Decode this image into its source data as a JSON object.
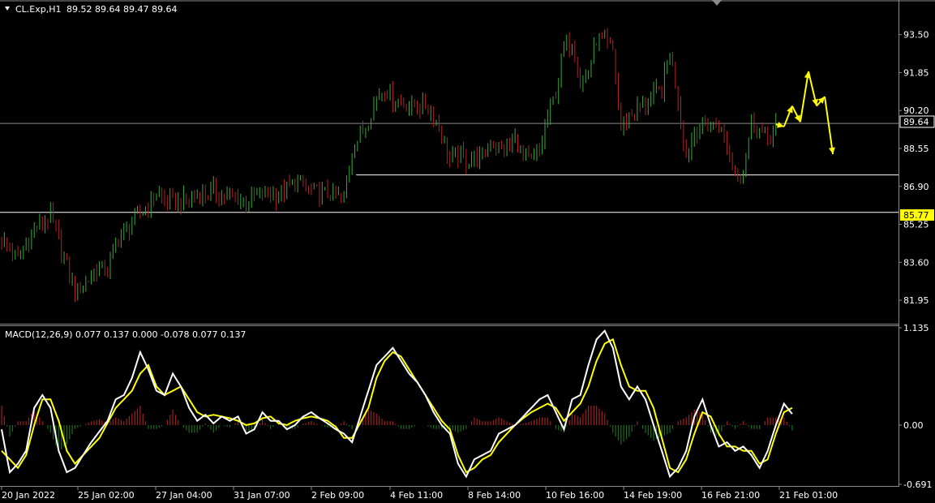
{
  "chart_header": {
    "symbol_label": "CL.Exp,H1",
    "ohlc_text": "89.52 89.64 89.47 89.64",
    "macd_label": "MACD(12,26,9) 0.077 0.137 0.000 -0.078 0.077 0.137"
  },
  "colors": {
    "background": "#000000",
    "bull_candle": "#3aa83a",
    "bear_candle": "#b22222",
    "yellow": "#ffff00",
    "white": "#ffffff",
    "gray_line": "#8a8a8a",
    "hist_pos": "#a11e1e",
    "hist_neg": "#1d6b1d"
  },
  "chart_data": [
    {
      "type": "candlestick",
      "title": "CL.Exp,H1",
      "ylim": [
        81.0,
        94.3
      ],
      "y_ticks": [
        "93.50",
        "91.85",
        "90.20",
        "88.55",
        "86.90",
        "85.25",
        "83.60",
        "81.95"
      ],
      "y_tick_values": [
        93.5,
        91.85,
        90.2,
        88.55,
        86.9,
        85.25,
        83.6,
        81.95
      ],
      "x_ticks": [
        "20 Jan 2022",
        "25 Jan 02:00",
        "27 Jan 04:00",
        "31 Jan 07:00",
        "2 Feb 09:00",
        "4 Feb 11:00",
        "8 Feb 14:00",
        "10 Feb 16:00",
        "14 Feb 19:00",
        "16 Feb 21:00",
        "21 Feb 01:00"
      ],
      "current_price": "89.64",
      "current_price_value": 89.64,
      "support_label": "85.77",
      "support_value": 85.77,
      "horizontal_level_2": 87.4,
      "close_path": [
        [
          0,
          84.6
        ],
        [
          2,
          83.7
        ],
        [
          4,
          85.0
        ],
        [
          6,
          85.6
        ],
        [
          7,
          84.5
        ],
        [
          9,
          82.3
        ],
        [
          10,
          82.6
        ],
        [
          12,
          83.4
        ],
        [
          13,
          83.2
        ],
        [
          14,
          84.5
        ],
        [
          15,
          84.9
        ],
        [
          16,
          85.3
        ],
        [
          18,
          86.1
        ],
        [
          19,
          86.6
        ],
        [
          20,
          86.3
        ],
        [
          22,
          86.2
        ],
        [
          24,
          86.5
        ],
        [
          26,
          86.7
        ],
        [
          28,
          86.4
        ],
        [
          30,
          86.3
        ],
        [
          32,
          86.6
        ],
        [
          34,
          86.5
        ],
        [
          36,
          87.1
        ],
        [
          38,
          86.7
        ],
        [
          39,
          86.6
        ],
        [
          41,
          86.5
        ],
        [
          42,
          86.3
        ],
        [
          43,
          88.5
        ],
        [
          45,
          89.8
        ],
        [
          46,
          90.8
        ],
        [
          47,
          91.2
        ],
        [
          48,
          90.7
        ],
        [
          50,
          90.4
        ],
        [
          52,
          90.4
        ],
        [
          53,
          90.0
        ],
        [
          54,
          89.2
        ],
        [
          55,
          88.0
        ],
        [
          56,
          88.3
        ],
        [
          57,
          88.0
        ],
        [
          58,
          88.2
        ],
        [
          59,
          88.1
        ],
        [
          60,
          88.8
        ],
        [
          62,
          88.5
        ],
        [
          63,
          89.0
        ],
        [
          64,
          88.1
        ],
        [
          65,
          88.0
        ],
        [
          66,
          88.4
        ],
        [
          67,
          89.9
        ],
        [
          68,
          91.0
        ],
        [
          69,
          92.9
        ],
        [
          70,
          93.2
        ],
        [
          71,
          91.5
        ],
        [
          72,
          91.8
        ],
        [
          73,
          93.3
        ],
        [
          74,
          93.1
        ],
        [
          75,
          92.8
        ],
        [
          76,
          89.4
        ],
        [
          77,
          90.0
        ],
        [
          78,
          90.3
        ],
        [
          79,
          90.4
        ],
        [
          80,
          90.9
        ],
        [
          81,
          91.1
        ],
        [
          82,
          92.8
        ],
        [
          83,
          90.7
        ],
        [
          84,
          88.2
        ],
        [
          85,
          89.3
        ],
        [
          86,
          89.5
        ],
        [
          87,
          89.5
        ],
        [
          88,
          89.6
        ],
        [
          89,
          88.6
        ],
        [
          90,
          87.6
        ],
        [
          91,
          87.5
        ],
        [
          92,
          89.8
        ],
        [
          93,
          89.4
        ],
        [
          94,
          89.0
        ],
        [
          95,
          89.6
        ]
      ],
      "forecast_path": [
        [
          95,
          89.6
        ],
        [
          96,
          89.5
        ],
        [
          97,
          90.4
        ],
        [
          98,
          89.7
        ],
        [
          99,
          91.9
        ],
        [
          100,
          90.4
        ],
        [
          101,
          90.8
        ],
        [
          102,
          88.3
        ]
      ],
      "n_candles": 103
    },
    {
      "type": "macd",
      "title": "MACD(12,26,9)",
      "ylim": [
        -0.691,
        1.135
      ],
      "y_ticks": [
        "1.135",
        "0.00",
        "-0.691"
      ],
      "y_tick_values": [
        1.135,
        0.0,
        -0.691
      ],
      "macd_path": [
        [
          0,
          -0.05
        ],
        [
          1,
          -0.55
        ],
        [
          2,
          -0.45
        ],
        [
          3,
          -0.3
        ],
        [
          4,
          0.2
        ],
        [
          5,
          0.35
        ],
        [
          6,
          0.2
        ],
        [
          7,
          -0.3
        ],
        [
          8,
          -0.55
        ],
        [
          9,
          -0.5
        ],
        [
          11,
          -0.2
        ],
        [
          13,
          0.05
        ],
        [
          14,
          0.3
        ],
        [
          15,
          0.35
        ],
        [
          16,
          0.55
        ],
        [
          17,
          0.85
        ],
        [
          18,
          0.65
        ],
        [
          19,
          0.4
        ],
        [
          20,
          0.35
        ],
        [
          21,
          0.6
        ],
        [
          22,
          0.45
        ],
        [
          23,
          0.2
        ],
        [
          24,
          0.05
        ],
        [
          25,
          0.12
        ],
        [
          26,
          0.02
        ],
        [
          27,
          0.1
        ],
        [
          28,
          0.05
        ],
        [
          29,
          0.1
        ],
        [
          30,
          -0.1
        ],
        [
          31,
          -0.05
        ],
        [
          32,
          0.15
        ],
        [
          33,
          0.05
        ],
        [
          34,
          0.05
        ],
        [
          35,
          -0.05
        ],
        [
          36,
          0.0
        ],
        [
          37,
          0.1
        ],
        [
          38,
          0.15
        ],
        [
          39,
          0.08
        ],
        [
          40,
          0.02
        ],
        [
          41,
          -0.05
        ],
        [
          42,
          -0.1
        ],
        [
          43,
          -0.2
        ],
        [
          45,
          0.4
        ],
        [
          46,
          0.7
        ],
        [
          47,
          0.8
        ],
        [
          48,
          0.9
        ],
        [
          49,
          0.75
        ],
        [
          50,
          0.6
        ],
        [
          51,
          0.5
        ],
        [
          52,
          0.35
        ],
        [
          53,
          0.15
        ],
        [
          54,
          0.0
        ],
        [
          55,
          -0.1
        ],
        [
          56,
          -0.45
        ],
        [
          57,
          -0.6
        ],
        [
          58,
          -0.4
        ],
        [
          59,
          -0.35
        ],
        [
          60,
          -0.3
        ],
        [
          61,
          -0.1
        ],
        [
          62,
          -0.05
        ],
        [
          63,
          0.0
        ],
        [
          64,
          0.1
        ],
        [
          65,
          0.2
        ],
        [
          66,
          0.3
        ],
        [
          67,
          0.35
        ],
        [
          68,
          0.15
        ],
        [
          69,
          -0.05
        ],
        [
          70,
          0.3
        ],
        [
          71,
          0.35
        ],
        [
          72,
          0.7
        ],
        [
          73,
          1.0
        ],
        [
          74,
          1.1
        ],
        [
          75,
          0.9
        ],
        [
          76,
          0.45
        ],
        [
          77,
          0.3
        ],
        [
          78,
          0.45
        ],
        [
          79,
          0.3
        ],
        [
          80,
          0.0
        ],
        [
          81,
          -0.3
        ],
        [
          82,
          -0.6
        ],
        [
          83,
          -0.5
        ],
        [
          84,
          -0.3
        ],
        [
          85,
          0.1
        ],
        [
          86,
          0.3
        ],
        [
          87,
          0.0
        ],
        [
          88,
          -0.25
        ],
        [
          89,
          -0.2
        ],
        [
          90,
          -0.3
        ],
        [
          91,
          -0.25
        ],
        [
          92,
          -0.35
        ],
        [
          93,
          -0.5
        ],
        [
          94,
          -0.3
        ],
        [
          95,
          0.0
        ],
        [
          96,
          0.25
        ],
        [
          97,
          0.13
        ]
      ],
      "signal_path": [
        [
          0,
          -0.3
        ],
        [
          2,
          -0.5
        ],
        [
          3,
          -0.35
        ],
        [
          4,
          0.0
        ],
        [
          5,
          0.3
        ],
        [
          6,
          0.3
        ],
        [
          7,
          0.05
        ],
        [
          8,
          -0.3
        ],
        [
          9,
          -0.45
        ],
        [
          10,
          -0.35
        ],
        [
          12,
          -0.15
        ],
        [
          14,
          0.2
        ],
        [
          15,
          0.3
        ],
        [
          16,
          0.4
        ],
        [
          17,
          0.6
        ],
        [
          18,
          0.7
        ],
        [
          19,
          0.45
        ],
        [
          20,
          0.35
        ],
        [
          21,
          0.4
        ],
        [
          22,
          0.45
        ],
        [
          23,
          0.3
        ],
        [
          24,
          0.15
        ],
        [
          25,
          0.1
        ],
        [
          26,
          0.12
        ],
        [
          27,
          0.1
        ],
        [
          28,
          0.08
        ],
        [
          29,
          0.05
        ],
        [
          30,
          0.0
        ],
        [
          31,
          0.02
        ],
        [
          32,
          0.08
        ],
        [
          33,
          0.1
        ],
        [
          34,
          0.02
        ],
        [
          35,
          0.0
        ],
        [
          36,
          0.05
        ],
        [
          37,
          0.08
        ],
        [
          38,
          0.1
        ],
        [
          39,
          0.08
        ],
        [
          40,
          0.05
        ],
        [
          41,
          -0.02
        ],
        [
          42,
          -0.15
        ],
        [
          43,
          -0.15
        ],
        [
          45,
          0.2
        ],
        [
          46,
          0.55
        ],
        [
          47,
          0.75
        ],
        [
          48,
          0.85
        ],
        [
          49,
          0.8
        ],
        [
          50,
          0.65
        ],
        [
          51,
          0.5
        ],
        [
          52,
          0.35
        ],
        [
          53,
          0.2
        ],
        [
          54,
          0.05
        ],
        [
          55,
          -0.05
        ],
        [
          56,
          -0.35
        ],
        [
          57,
          -0.55
        ],
        [
          58,
          -0.5
        ],
        [
          59,
          -0.4
        ],
        [
          60,
          -0.35
        ],
        [
          61,
          -0.2
        ],
        [
          62,
          -0.1
        ],
        [
          63,
          0.0
        ],
        [
          64,
          0.08
        ],
        [
          65,
          0.15
        ],
        [
          66,
          0.2
        ],
        [
          67,
          0.25
        ],
        [
          68,
          0.2
        ],
        [
          69,
          0.05
        ],
        [
          70,
          0.15
        ],
        [
          71,
          0.25
        ],
        [
          72,
          0.45
        ],
        [
          73,
          0.75
        ],
        [
          74,
          0.95
        ],
        [
          75,
          1.0
        ],
        [
          76,
          0.7
        ],
        [
          77,
          0.45
        ],
        [
          78,
          0.4
        ],
        [
          79,
          0.4
        ],
        [
          80,
          0.2
        ],
        [
          81,
          -0.15
        ],
        [
          82,
          -0.5
        ],
        [
          83,
          -0.55
        ],
        [
          84,
          -0.4
        ],
        [
          85,
          -0.1
        ],
        [
          86,
          0.15
        ],
        [
          87,
          0.1
        ],
        [
          88,
          -0.1
        ],
        [
          89,
          -0.25
        ],
        [
          90,
          -0.25
        ],
        [
          91,
          -0.3
        ],
        [
          92,
          -0.3
        ],
        [
          93,
          -0.45
        ],
        [
          94,
          -0.4
        ],
        [
          95,
          -0.1
        ],
        [
          96,
          0.15
        ],
        [
          97,
          0.2
        ]
      ]
    }
  ]
}
